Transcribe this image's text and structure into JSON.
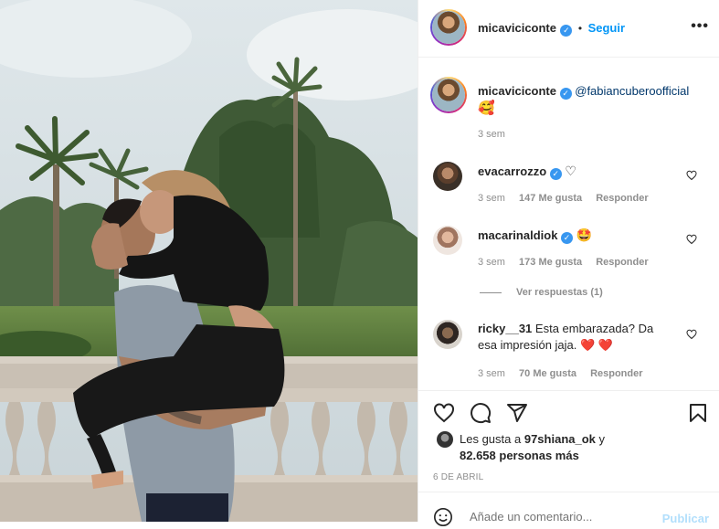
{
  "post_author": {
    "username": "micaviciconte",
    "follow_label": "Seguir",
    "separator": "•",
    "more_label": "•••"
  },
  "caption": {
    "username": "micaviciconte",
    "mention": "@fabiancuberoofficial",
    "emoji": "🥰",
    "time": "3 sem"
  },
  "comments": [
    {
      "username": "evacarrozzo",
      "text": "♡",
      "time": "3 sem",
      "likes": "147 Me gusta",
      "reply_label": "Responder"
    },
    {
      "username": "macarinaldiok",
      "text": "🤩",
      "time": "3 sem",
      "likes": "173 Me gusta",
      "reply_label": "Responder"
    },
    {
      "username": "ricky__31",
      "text": "Esta embarazada? Da esa impresión jaja. ❤️ ❤️",
      "time": "3 sem",
      "likes": "70 Me gusta",
      "reply_label": "Responder"
    }
  ],
  "view_replies_label": "Ver respuestas (1)",
  "likes_summary": {
    "prefix": "Les gusta a",
    "user": "97shiana_ok",
    "conj": "y",
    "others": "82.658 personas más"
  },
  "post_date": "6 DE ABRIL",
  "comment_input": {
    "placeholder": "Añade un comentario...",
    "publish_label": "Publicar"
  },
  "colors": {
    "accent": "#0095f6",
    "verified": "#3897f0",
    "heart_red": "#ed4956"
  },
  "icons": [
    "heart-icon",
    "comment-icon",
    "share-icon",
    "bookmark-icon",
    "emoji-icon",
    "verified-badge-icon",
    "more-options-icon"
  ]
}
